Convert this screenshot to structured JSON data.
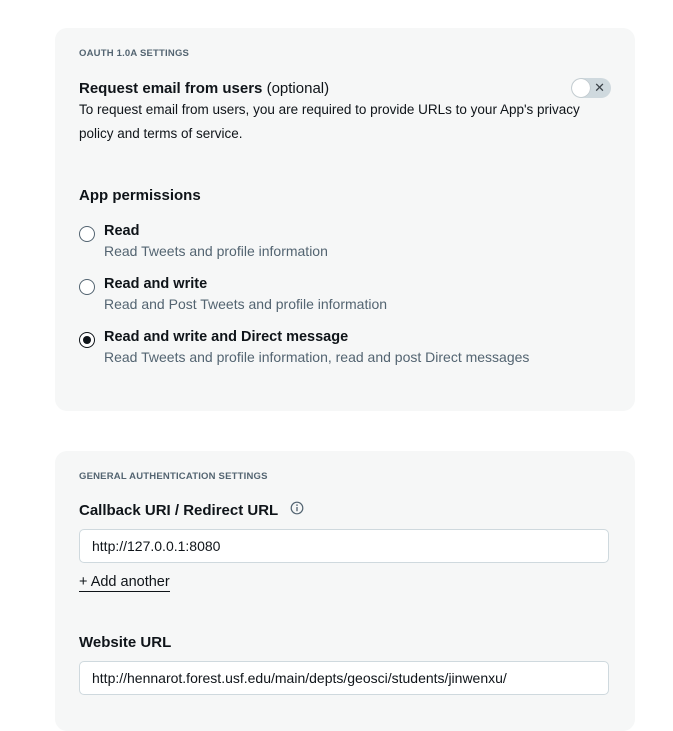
{
  "oauth": {
    "section_label": "OAUTH 1.0A SETTINGS",
    "request_email_title": "Request email from users",
    "request_email_optional": "(optional)",
    "request_email_desc": "To request email from users, you are required to provide URLs to your App's privacy policy and terms of service.",
    "toggle_enabled": false,
    "toggle_icon": "close-icon",
    "permissions_heading": "App permissions",
    "permissions": [
      {
        "label": "Read",
        "desc": "Read Tweets and profile information",
        "checked": false
      },
      {
        "label": "Read and write",
        "desc": "Read and Post Tweets and profile information",
        "checked": false
      },
      {
        "label": "Read and write and Direct message",
        "desc": "Read Tweets and profile information, read and post Direct messages",
        "checked": true
      }
    ]
  },
  "general": {
    "section_label": "GENERAL AUTHENTICATION SETTINGS",
    "callback_label": "Callback URI / Redirect URL",
    "callback_info_icon": "info-icon",
    "callback_value": "http://127.0.0.1:8080",
    "add_another": "+ Add another",
    "website_label": "Website URL",
    "website_value": "http://hennarot.forest.usf.edu/main/depts/geosci/students/jinwenxu/"
  }
}
